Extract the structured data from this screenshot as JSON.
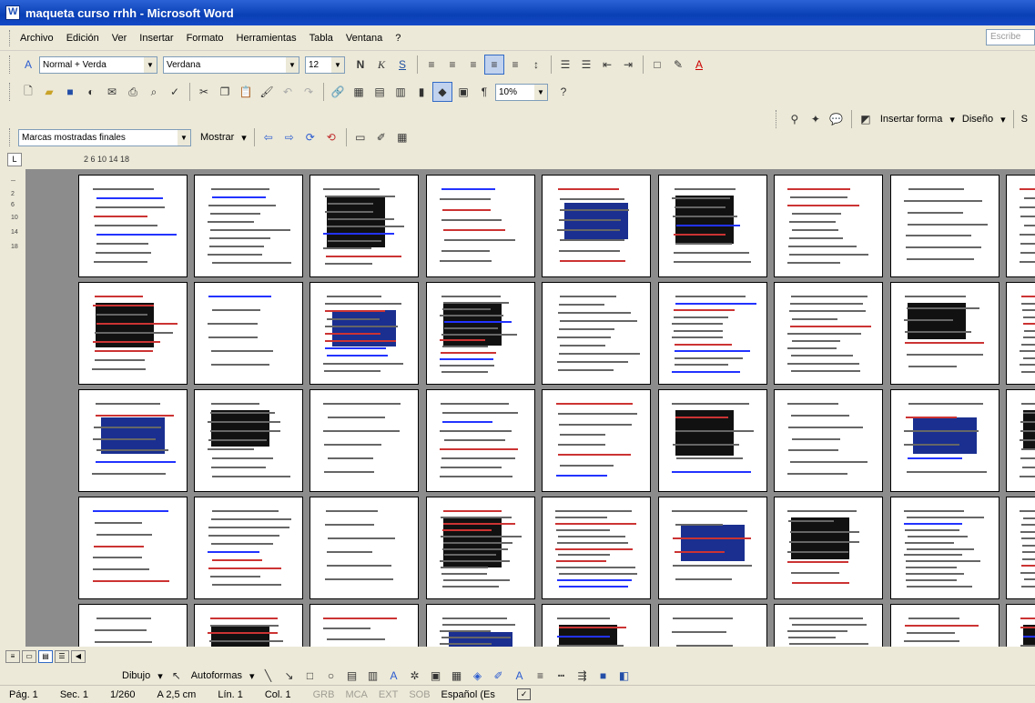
{
  "window": {
    "title": "maqueta curso rrhh - Microsoft Word"
  },
  "menubar": {
    "items": [
      "Archivo",
      "Edición",
      "Ver",
      "Insertar",
      "Formato",
      "Herramientas",
      "Tabla",
      "Ventana",
      "?"
    ],
    "ask_placeholder": "Escribe"
  },
  "formatting": {
    "style": "Normal + Verda",
    "font": "Verdana",
    "size": "12",
    "bold": "N",
    "italic": "K",
    "underline": "S"
  },
  "standard": {
    "zoom": "10%",
    "pilcrow": "¶"
  },
  "drawing_top": {
    "insert_shape": "Insertar forma",
    "design": "Diseño",
    "trail": "S"
  },
  "reviewing": {
    "markup": "Marcas mostradas finales",
    "show": "Mostrar"
  },
  "ruler": {
    "corner": "L",
    "h_marks": "2  6  10  14 18"
  },
  "drawbar": {
    "draw": "Dibujo",
    "autoshapes": "Autoformas"
  },
  "statusbar": {
    "page": "Pág. 1",
    "section": "Sec. 1",
    "pages": "1/260",
    "at": "A 2,5 cm",
    "line": "Lín. 1",
    "col": "Col. 1",
    "grb": "GRB",
    "mca": "MCA",
    "ext": "EXT",
    "sob": "SOB",
    "language": "Español (Es"
  },
  "colors": {
    "title_blue": "#0a3fb5",
    "doc_bg": "#8c8c8c",
    "chrome": "#ece9d8"
  }
}
